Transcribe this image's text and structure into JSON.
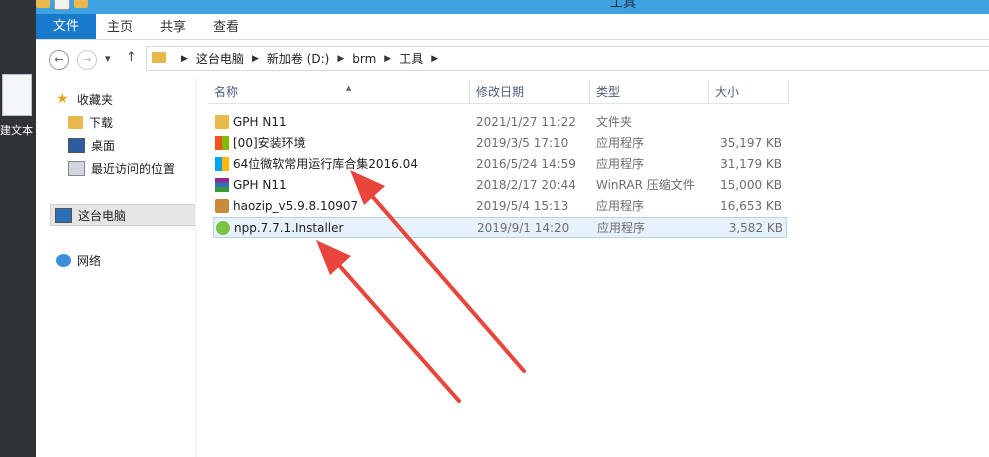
{
  "window": {
    "title": "工具"
  },
  "desktop": {
    "label": "建文本"
  },
  "ribbon": {
    "tabs": [
      "文件",
      "主页",
      "共享",
      "查看"
    ]
  },
  "breadcrumb": [
    "这台电脑",
    "新加卷 (D:)",
    "brm",
    "工具"
  ],
  "nav": {
    "favorites": "收藏夹",
    "downloads": "下载",
    "desktop": "桌面",
    "recent": "最近访问的位置",
    "this_pc": "这台电脑",
    "network": "网络"
  },
  "columns": {
    "name": "名称",
    "date": "修改日期",
    "type": "类型",
    "size": "大小"
  },
  "files": [
    {
      "name": "GPH N11",
      "date": "2021/1/27 11:22",
      "type": "文件夹",
      "size": "",
      "icon": "folder-icon"
    },
    {
      "name": "[00]安装环境",
      "date": "2019/3/5 17:10",
      "type": "应用程序",
      "size": "35,197 KB",
      "icon": "app-icon"
    },
    {
      "name": "64位微软常用运行库合集2016.04",
      "date": "2016/5/24 14:59",
      "type": "应用程序",
      "size": "31,179 KB",
      "icon": "app-icon"
    },
    {
      "name": "GPH N11",
      "date": "2018/2/17 20:44",
      "type": "WinRAR 压缩文件",
      "size": "15,000 KB",
      "icon": "winrar-icon"
    },
    {
      "name": "haozip_v5.9.8.10907",
      "date": "2019/5/4 15:13",
      "type": "应用程序",
      "size": "16,653 KB",
      "icon": "haozip-icon"
    },
    {
      "name": "npp.7.7.1.Installer",
      "date": "2019/9/1 14:20",
      "type": "应用程序",
      "size": "3,582 KB",
      "icon": "notepadpp-icon"
    }
  ],
  "colors": {
    "accent": "#1979ca",
    "titlebar": "#3ea1e1",
    "annotation": "#e8453c"
  }
}
